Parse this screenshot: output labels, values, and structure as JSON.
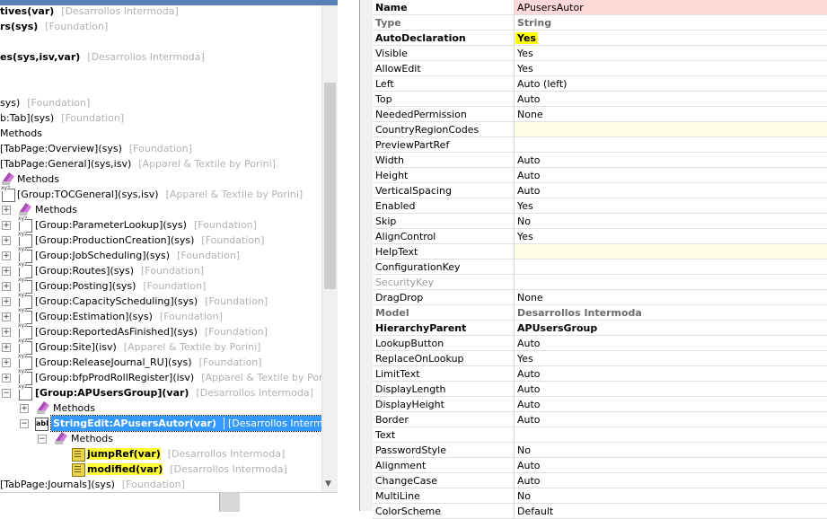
{
  "tree": {
    "rows": [
      {
        "name": "tives(var)",
        "layer": "[Desarrollos Intermoda]",
        "bold": true
      },
      {
        "name": "rs(sys)",
        "layer": "[Foundation]",
        "bold": true
      },
      {
        "name": "",
        "layer": ""
      },
      {
        "name": "es(sys,isv,var)",
        "layer": "[Desarrollos Intermoda]",
        "bold": true
      },
      {
        "name": "",
        "layer": ""
      },
      {
        "name": "sys)",
        "layer": "[Foundation]"
      },
      {
        "name": "b:Tab](sys)",
        "layer": "[Foundation]"
      },
      {
        "name": "Methods",
        "layer": ""
      },
      {
        "name": "[TabPage:Overview](sys)",
        "layer": "[Foundation]"
      },
      {
        "name": "[TabPage:General](sys,isv)",
        "layer": "[Apparel & Textile by Porini]"
      },
      {
        "name": "Methods",
        "layer": ""
      },
      {
        "name": "[Group:TOCGeneral](sys,isv)",
        "layer": "[Apparel & Textile by Porini]"
      },
      {
        "name": "Methods",
        "layer": ""
      },
      {
        "name": "[Group:ParameterLookup](sys)",
        "layer": "[Foundation]"
      },
      {
        "name": "[Group:ProductionCreation](sys)",
        "layer": "[Foundation]"
      },
      {
        "name": "[Group:JobScheduling](sys)",
        "layer": "[Foundation]"
      },
      {
        "name": "[Group:Routes](sys)",
        "layer": "[Foundation]"
      },
      {
        "name": "[Group:Posting](sys)",
        "layer": "[Foundation]"
      },
      {
        "name": "[Group:CapacityScheduling](sys)",
        "layer": "[Foundation]"
      },
      {
        "name": "[Group:Estimation](sys)",
        "layer": "[Foundation]"
      },
      {
        "name": "[Group:ReportedAsFinished](sys)",
        "layer": "[Foundation]"
      },
      {
        "name": "[Group:Site](isv)",
        "layer": "[Apparel & Textile by Porini]"
      },
      {
        "name": "[Group:ReleaseJournal_RU](sys)",
        "layer": "[Foundation]"
      },
      {
        "name": "[Group:bfpProdRollRegister](isv)",
        "layer": "[Apparel & Textile by Porini]"
      },
      {
        "name": "[Group:APUsersGroup](var)",
        "layer": "[Desarrollos Intermoda]",
        "bold": true
      },
      {
        "name": "Methods",
        "layer": ""
      },
      {
        "name": "StringEdit:APusersAutor(var)",
        "layer": "[Desarrollos Intermoda]",
        "bold": true
      },
      {
        "name": "Methods",
        "layer": ""
      },
      {
        "name": "jumpRef(var)",
        "layer": "[Desarrollos Intermoda]",
        "bold": true
      },
      {
        "name": "modified(var)",
        "layer": "[Desarrollos Intermoda]",
        "bold": true
      },
      {
        "name": "[TabPage:Journals](sys)",
        "layer": "[Foundation]"
      }
    ]
  },
  "properties": {
    "rows": [
      {
        "name": "Name",
        "value": "APusersAutor"
      },
      {
        "name": "Type",
        "value": "String"
      },
      {
        "name": "AutoDeclaration",
        "value": "Yes"
      },
      {
        "name": "Visible",
        "value": "Yes"
      },
      {
        "name": "AllowEdit",
        "value": "Yes"
      },
      {
        "name": "Left",
        "value": "Auto (left)"
      },
      {
        "name": "Top",
        "value": "Auto"
      },
      {
        "name": "NeededPermission",
        "value": "None"
      },
      {
        "name": "CountryRegionCodes",
        "value": ""
      },
      {
        "name": "PreviewPartRef",
        "value": ""
      },
      {
        "name": "Width",
        "value": "Auto"
      },
      {
        "name": "Height",
        "value": "Auto"
      },
      {
        "name": "VerticalSpacing",
        "value": "Auto"
      },
      {
        "name": "Enabled",
        "value": "Yes"
      },
      {
        "name": "Skip",
        "value": "No"
      },
      {
        "name": "AlignControl",
        "value": "Yes"
      },
      {
        "name": "HelpText",
        "value": ""
      },
      {
        "name": "ConfigurationKey",
        "value": ""
      },
      {
        "name": "SecurityKey",
        "value": ""
      },
      {
        "name": "DragDrop",
        "value": "None"
      },
      {
        "name": "Model",
        "value": "Desarrollos Intermoda"
      },
      {
        "name": "HierarchyParent",
        "value": "APUsersGroup"
      },
      {
        "name": "LookupButton",
        "value": "Auto"
      },
      {
        "name": "ReplaceOnLookup",
        "value": "Yes"
      },
      {
        "name": "LimitText",
        "value": "Auto"
      },
      {
        "name": "DisplayLength",
        "value": "Auto"
      },
      {
        "name": "DisplayHeight",
        "value": "Auto"
      },
      {
        "name": "Border",
        "value": "Auto"
      },
      {
        "name": "Text",
        "value": ""
      },
      {
        "name": "PasswordStyle",
        "value": "No"
      },
      {
        "name": "Alignment",
        "value": "Auto"
      },
      {
        "name": "ChangeCase",
        "value": "Auto"
      },
      {
        "name": "MultiLine",
        "value": "No"
      },
      {
        "name": "ColorScheme",
        "value": "Default"
      }
    ]
  }
}
